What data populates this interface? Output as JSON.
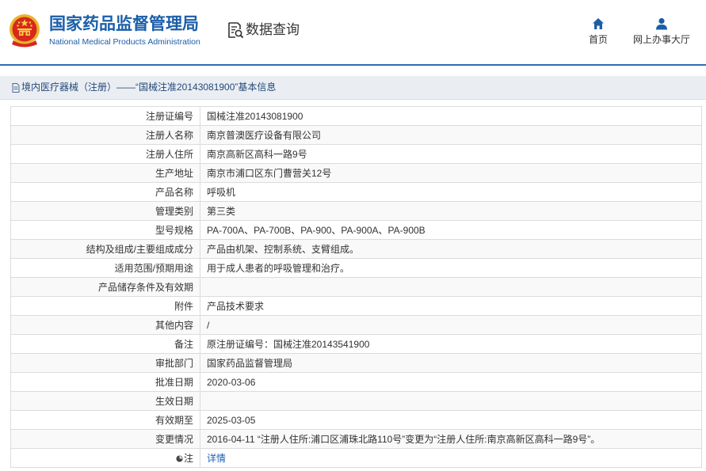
{
  "header": {
    "emblem_icon": "national-emblem-icon",
    "org_name_cn": "国家药品监督管理局",
    "org_name_en": "National Medical Products Administration",
    "section_icon": "data-query-icon",
    "section_title": "数据查询",
    "nav": [
      {
        "label": "首页",
        "icon": "home-icon"
      },
      {
        "label": "网上办事大厅",
        "icon": "user-icon"
      }
    ]
  },
  "breadcrumb": {
    "icon": "document-icon",
    "text": "境内医疗器械（注册）——“国械注准20143081900”基本信息"
  },
  "details": {
    "rows": [
      {
        "label": "注册证编号",
        "value": "国械注准20143081900"
      },
      {
        "label": "注册人名称",
        "value": "南京普澳医疗设备有限公司"
      },
      {
        "label": "注册人住所",
        "value": "南京高新区高科一路9号"
      },
      {
        "label": "生产地址",
        "value": "南京市浦口区东门曹营关12号"
      },
      {
        "label": "产品名称",
        "value": "呼吸机"
      },
      {
        "label": "管理类别",
        "value": "第三类"
      },
      {
        "label": "型号规格",
        "value": "PA-700A、PA-700B、PA-900、PA-900A、PA-900B"
      },
      {
        "label": "结构及组成/主要组成成分",
        "value": "产品由机架、控制系统、支臂组成。"
      },
      {
        "label": "适用范围/预期用途",
        "value": "用于成人患者的呼吸管理和治疗。"
      },
      {
        "label": "产品储存条件及有效期",
        "value": ""
      },
      {
        "label": "附件",
        "value": "产品技术要求"
      },
      {
        "label": "其他内容",
        "value": "/"
      },
      {
        "label": "备注",
        "value": "原注册证编号：国械注准20143541900"
      },
      {
        "label": "审批部门",
        "value": "国家药品监督管理局"
      },
      {
        "label": "批准日期",
        "value": "2020-03-06"
      },
      {
        "label": "生效日期",
        "value": ""
      },
      {
        "label": "有效期至",
        "value": "2025-03-05"
      },
      {
        "label": "变更情况",
        "value": "2016-04-11 “注册人住所:浦口区浦珠北路110号”变更为“注册人住所:南京高新区高科一路9号”。"
      },
      {
        "label": "注",
        "label_icon": "note-bullet-icon",
        "value": "详情"
      }
    ]
  },
  "colors": {
    "brand_blue": "#1b5ea8",
    "link_blue": "#1a5fb4",
    "breadcrumb_text": "#24497a",
    "table_border": "#dcdcdc"
  }
}
